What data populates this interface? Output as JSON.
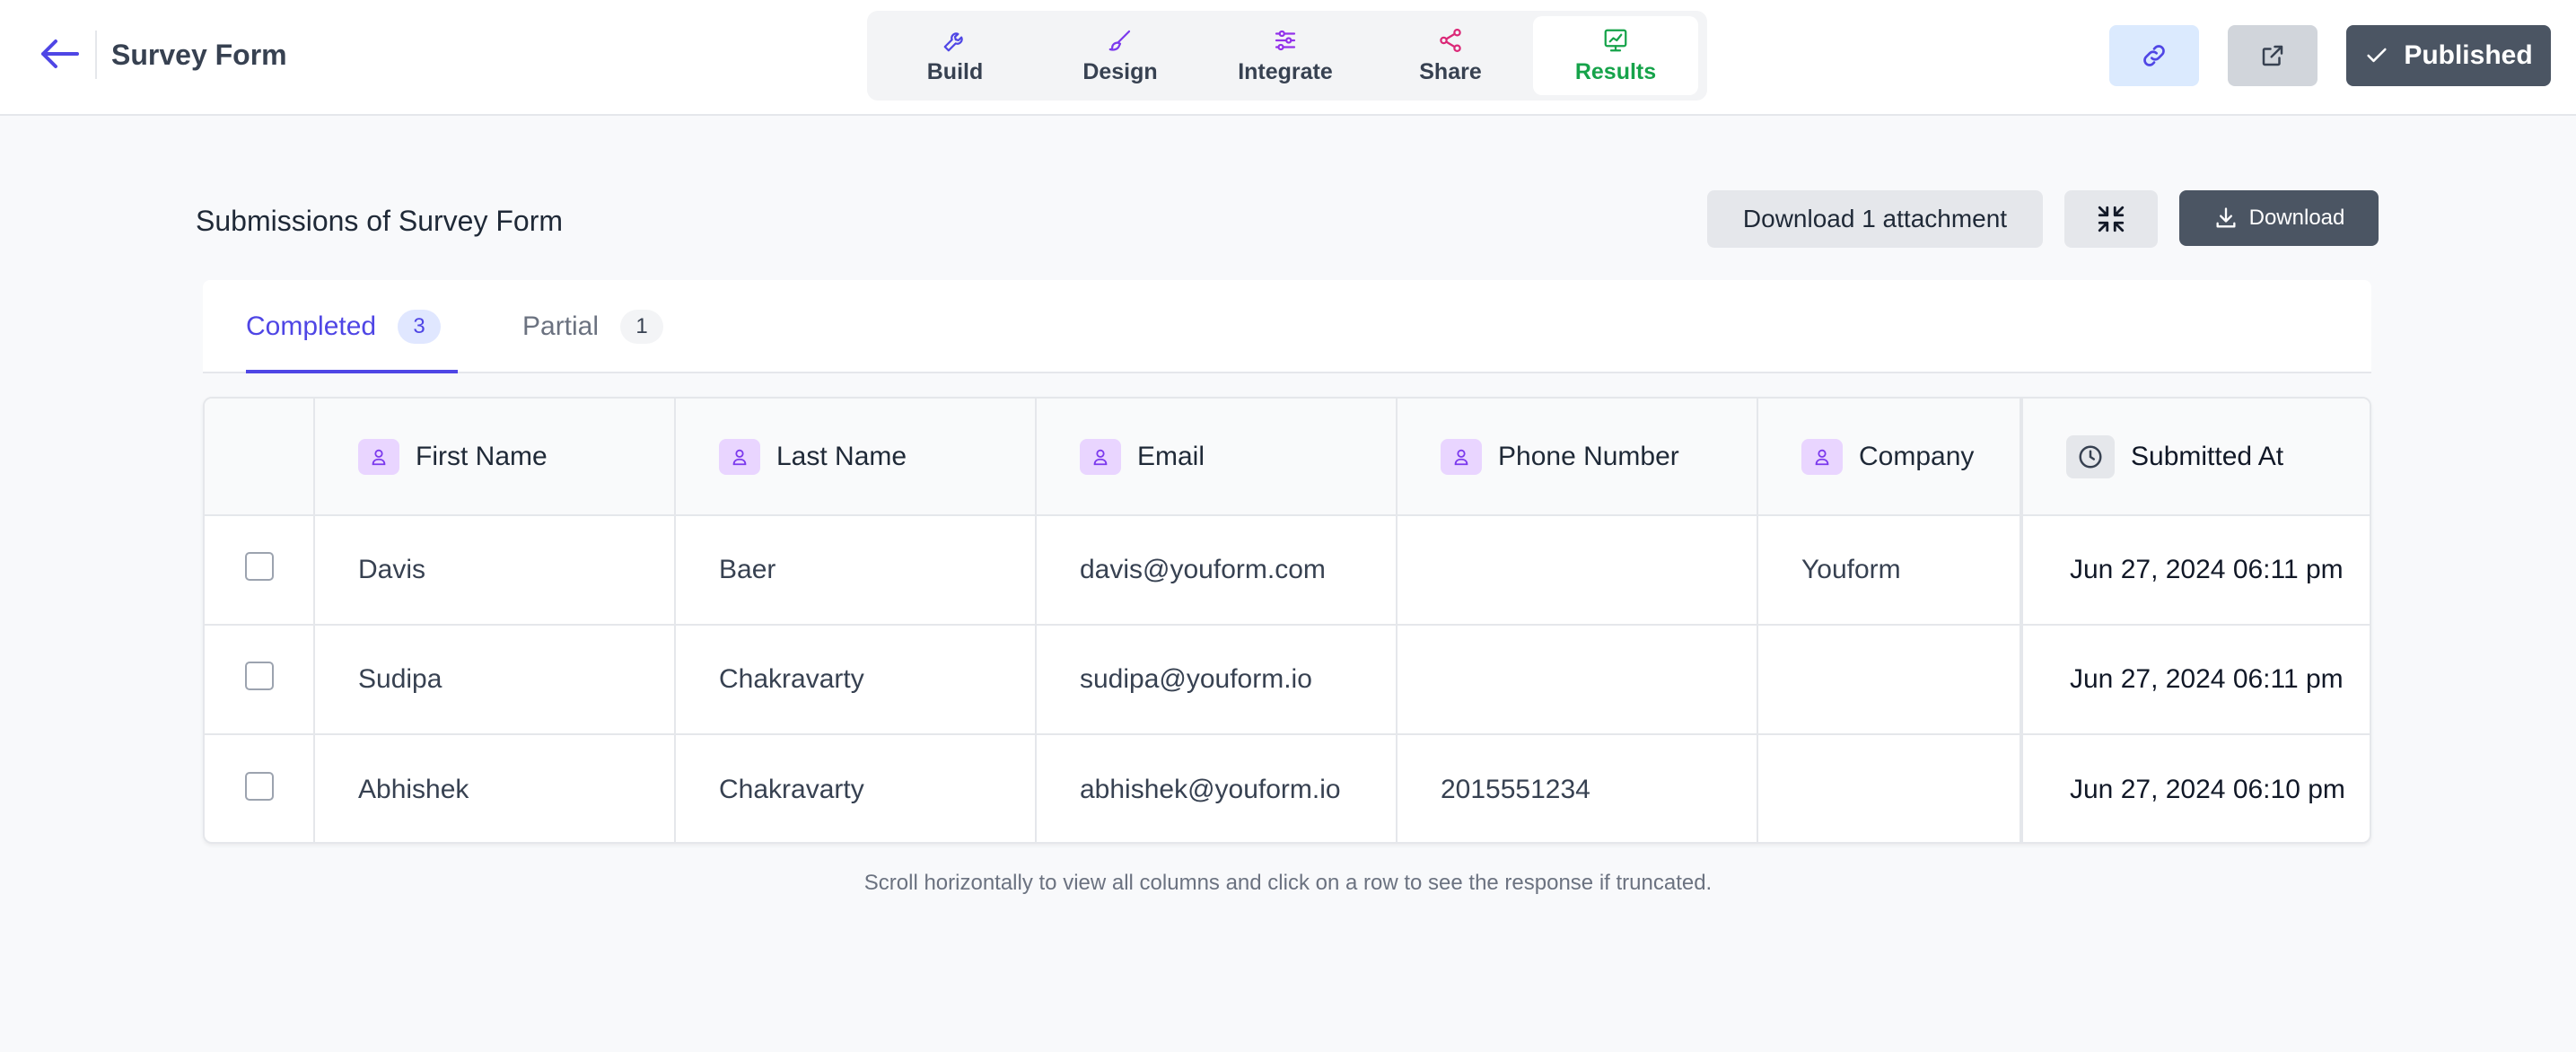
{
  "header": {
    "title": "Survey Form",
    "tabs": [
      {
        "label": "Build",
        "icon": "wrench-icon",
        "color": "#4f46e5"
      },
      {
        "label": "Design",
        "icon": "paintbrush-icon",
        "color": "#7c3aed"
      },
      {
        "label": "Integrate",
        "icon": "sliders-icon",
        "color": "#9333ea"
      },
      {
        "label": "Share",
        "icon": "share-icon",
        "color": "#db2777"
      },
      {
        "label": "Results",
        "icon": "chart-icon",
        "color": "#16a34a"
      }
    ],
    "active_tab": "Results",
    "publish_label": "Published"
  },
  "results": {
    "title": "Submissions of Survey Form",
    "download_attachment_label": "Download 1 attachment",
    "download_label": "Download",
    "tabs": [
      {
        "label": "Completed",
        "count": "3"
      },
      {
        "label": "Partial",
        "count": "1"
      }
    ]
  },
  "table": {
    "columns": [
      "First Name",
      "Last Name",
      "Email",
      "Phone Number",
      "Company",
      "Submitted At"
    ],
    "rows": [
      [
        "Davis",
        "Baer",
        "davis@youform.com",
        "",
        "Youform",
        "Jun 27, 2024 06:11 pm"
      ],
      [
        "Sudipa",
        "Chakravarty",
        "sudipa@youform.io",
        "",
        "",
        "Jun 27, 2024 06:11 pm"
      ],
      [
        "Abhishek",
        "Chakravarty",
        "abhishek@youform.io",
        "2015551234",
        "",
        "Jun 27, 2024 06:10 pm"
      ]
    ]
  },
  "hint": "Scroll horizontally to view all columns and click on a row to see the response if truncated.",
  "colors": {
    "accent": "#4f46e5",
    "active_tab": "#16a34a",
    "primary_button": "#4b5563",
    "field_icon_bg": "#e9d5ff"
  }
}
